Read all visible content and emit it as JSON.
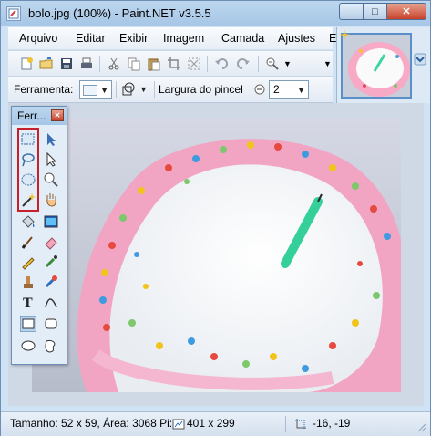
{
  "window": {
    "title": "bolo.jpg (100%) - Paint.NET v3.5.5"
  },
  "menu": [
    "Arquivo",
    "Editar",
    "Exibir",
    "Imagem",
    "Camada",
    "Ajustes",
    "Ef"
  ],
  "toolbar2": {
    "tool_label": "Ferramenta:",
    "brush_width_label": "Largura do pincel",
    "brush_width_value": "2"
  },
  "tools_window": {
    "title": "Ferr..."
  },
  "status": {
    "size_area": "Tamanho: 52 x 59, Área: 3068 Pi:",
    "image_size": "401 x 299",
    "cursor": "-16, -19"
  }
}
